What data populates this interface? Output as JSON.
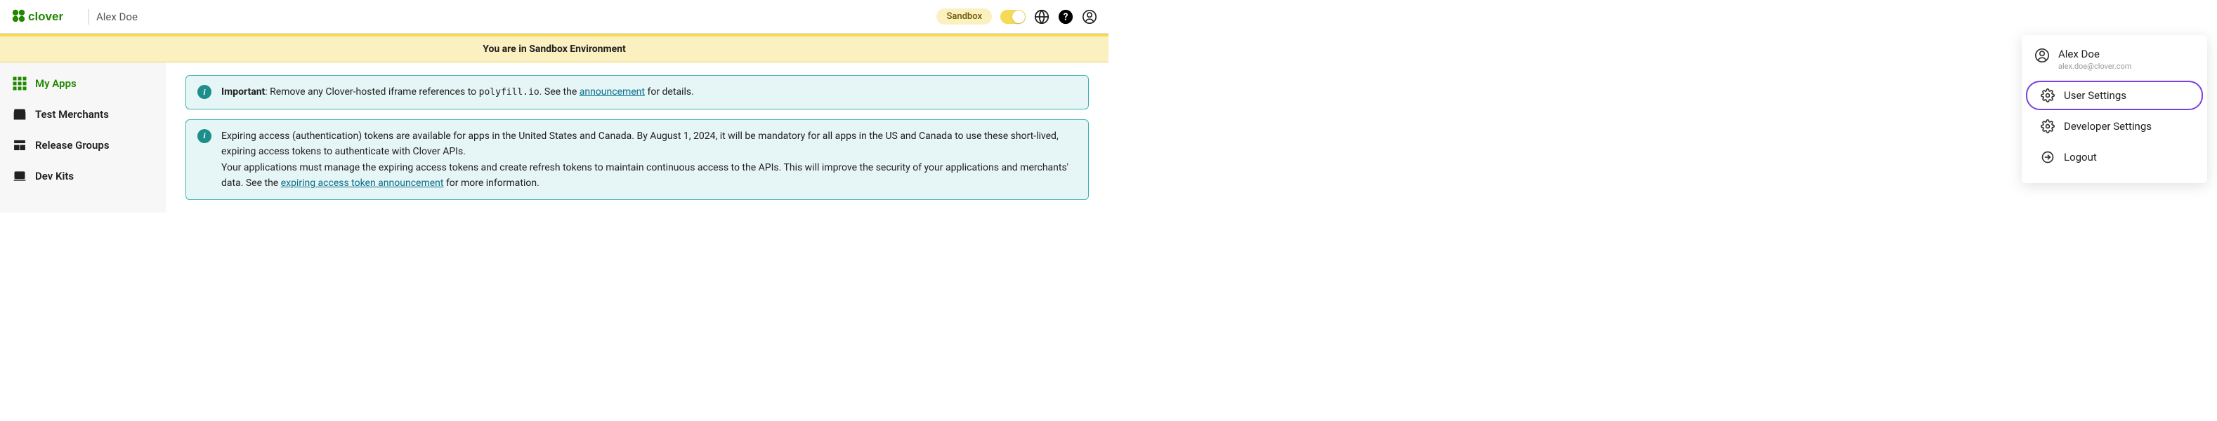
{
  "header": {
    "brand": "clover",
    "username": "Alex Doe",
    "sandbox_badge": "Sandbox"
  },
  "banner": {
    "text": "You are in Sandbox Environment"
  },
  "sidebar": {
    "items": [
      {
        "label": "My Apps"
      },
      {
        "label": "Test Merchants"
      },
      {
        "label": "Release Groups"
      },
      {
        "label": "Dev Kits"
      }
    ]
  },
  "alerts": [
    {
      "strong": "Important",
      "pre": ": Remove any Clover-hosted iframe references to ",
      "code": "polyfill.io",
      "mid": ". See the ",
      "link": "announcement",
      "post": " for details."
    },
    {
      "line1": "Expiring access (authentication) tokens are available for apps in the United States and Canada. By August 1, 2024, it will be mandatory for all apps in the US and Canada to use these short-lived, expiring access tokens to authenticate with Clover APIs.",
      "line2_pre": "Your applications must manage the expiring access tokens and create refresh tokens to maintain continuous access to the APIs. This will improve the security of your applications and merchants' data. See the ",
      "line2_link": "expiring access token announcement",
      "line2_post": " for more information."
    }
  ],
  "dropdown": {
    "user_name": "Alex Doe",
    "user_email": "alex.doe@clover.com",
    "items": [
      {
        "label": "User Settings"
      },
      {
        "label": "Developer Settings"
      },
      {
        "label": "Logout"
      }
    ]
  }
}
